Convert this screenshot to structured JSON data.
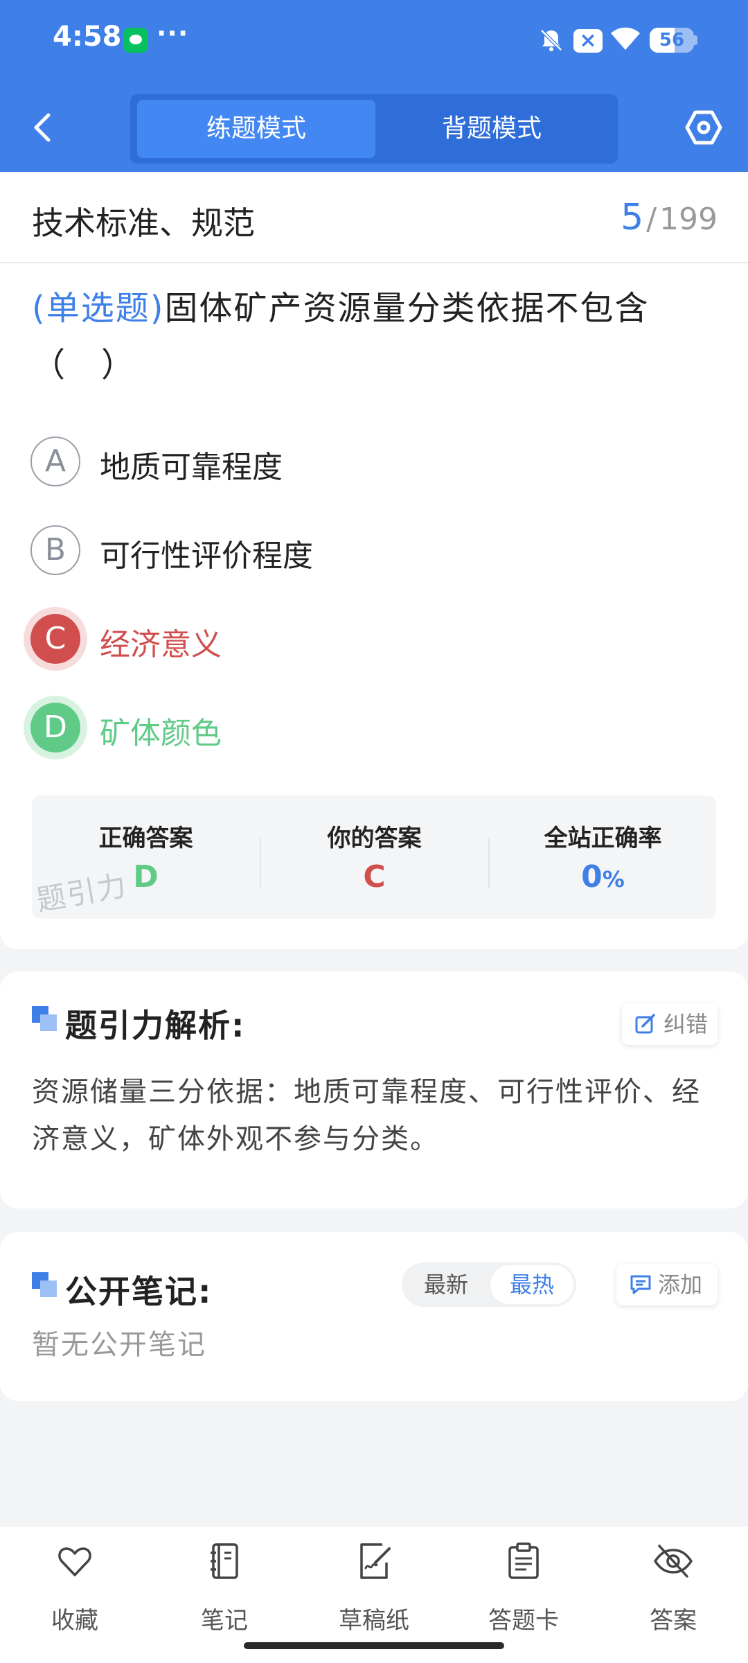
{
  "status_bar": {
    "time": "4:58",
    "dots": "···",
    "battery": "56",
    "battery_level": 0.56
  },
  "header": {
    "modes": [
      "练题模式",
      "背题模式"
    ],
    "active_mode": "练题模式"
  },
  "question": {
    "section": "技术标准、规范",
    "current": "5",
    "separator": "/",
    "total": "199",
    "type_label": "(单选题)",
    "stem": "固体矿产资源量分类依据不包含（　）",
    "options": [
      {
        "letter": "A",
        "text": "地质可靠程度",
        "state": "normal"
      },
      {
        "letter": "B",
        "text": "可行性评价程度",
        "state": "normal"
      },
      {
        "letter": "C",
        "text": "经济意义",
        "state": "wrong"
      },
      {
        "letter": "D",
        "text": "矿体颜色",
        "state": "correct"
      }
    ]
  },
  "answer_summary": {
    "correct_label": "正确答案",
    "correct_value": "D",
    "yours_label": "你的答案",
    "yours_value": "C",
    "rate_label": "全站正确率",
    "rate_value": "0",
    "rate_unit": "%",
    "watermark": "题引力"
  },
  "analysis": {
    "title": "题引力解析:",
    "report_label": "纠错",
    "text": "资源储量三分依据：地质可靠程度、可行性评价、经济意义，矿体外观不参与分类。"
  },
  "notes": {
    "title": "公开笔记:",
    "sort_options": [
      "最新",
      "最热"
    ],
    "active_sort": "最热",
    "add_label": "添加",
    "empty_text": "暂无公开笔记"
  },
  "toolbar": [
    {
      "label": "收藏",
      "icon": "heart-icon"
    },
    {
      "label": "笔记",
      "icon": "notebook-icon"
    },
    {
      "label": "草稿纸",
      "icon": "draft-paper-icon"
    },
    {
      "label": "答题卡",
      "icon": "answer-sheet-icon"
    },
    {
      "label": "答案",
      "icon": "eye-off-icon"
    }
  ],
  "colors": {
    "primary": "#3f7fe8",
    "wrong": "#d14e4e",
    "correct": "#5fcb86"
  }
}
